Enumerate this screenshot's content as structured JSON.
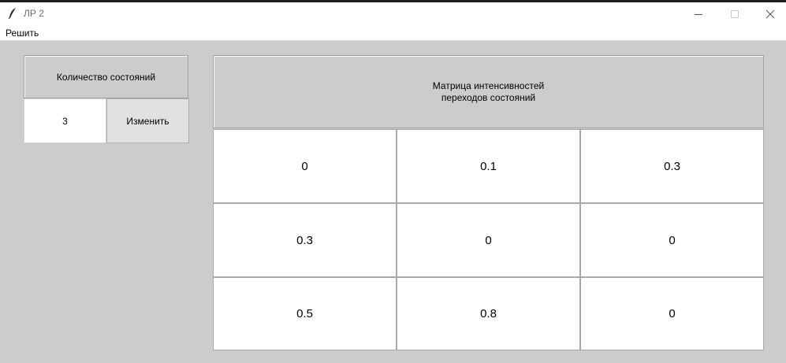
{
  "window": {
    "title": "ЛР 2"
  },
  "menu": {
    "items": [
      "Решить"
    ]
  },
  "left_panel": {
    "label": "Количество состояний",
    "count_value": "3",
    "change_button": "Изменить"
  },
  "matrix": {
    "header_line1": "Матрица интенсивностей",
    "header_line2": "переходов состояний",
    "rows": [
      [
        "0",
        "0.1",
        "0.3"
      ],
      [
        "0.3",
        "0",
        "0"
      ],
      [
        "0.5",
        "0.8",
        "0"
      ]
    ]
  },
  "icons": {
    "app": "feather-icon",
    "minimize": "minimize-icon",
    "maximize": "maximize-icon",
    "close": "close-icon"
  }
}
